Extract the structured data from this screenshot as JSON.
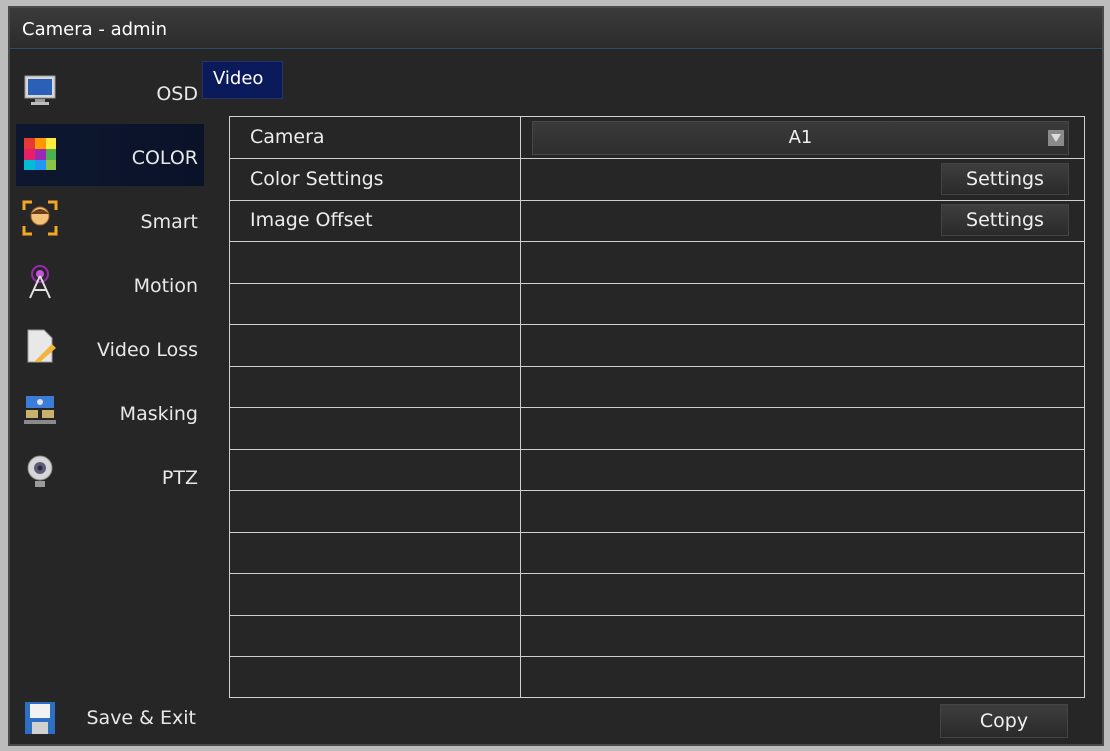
{
  "window": {
    "title": "Camera - admin"
  },
  "sidebar": {
    "items": [
      {
        "label": "OSD",
        "icon": "monitor-osd-icon"
      },
      {
        "label": "COLOR",
        "icon": "color-palette-icon",
        "active": true
      },
      {
        "label": "Smart",
        "icon": "face-detect-icon"
      },
      {
        "label": "Motion",
        "icon": "motion-antenna-icon"
      },
      {
        "label": "Video Loss",
        "icon": "video-loss-document-icon"
      },
      {
        "label": "Masking",
        "icon": "masking-icon"
      },
      {
        "label": "PTZ",
        "icon": "ptz-camera-icon"
      }
    ],
    "save_exit": {
      "label": "Save & Exit",
      "icon": "floppy-disk-icon"
    }
  },
  "tabs": [
    {
      "label": "Video",
      "active": true
    }
  ],
  "table": {
    "rows": [
      {
        "label": "Camera",
        "control": "dropdown",
        "value": "A1"
      },
      {
        "label": "Color Settings",
        "control": "button",
        "button_label": "Settings"
      },
      {
        "label": "Image Offset",
        "control": "button",
        "button_label": "Settings"
      }
    ],
    "empty_row_count": 11
  },
  "footer": {
    "copy_label": "Copy"
  },
  "colors": {
    "background": "#262626",
    "active_item": "#0d1830",
    "tab": "#0b1a5a",
    "grid_line": "#cfcfcf",
    "text": "#ececec"
  }
}
